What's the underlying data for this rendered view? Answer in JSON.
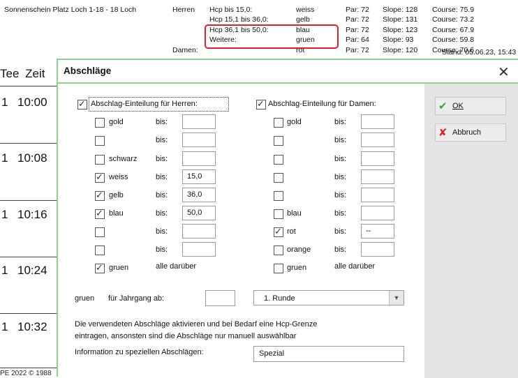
{
  "background": {
    "course_title": "Sonnenschein Platz Loch 1-18 - 18 Loch",
    "herren_label": "Herren",
    "damen_label": "Damen:",
    "stand": "Stand: 05.06.23, 15:43",
    "tee_rows": [
      {
        "hcp": "Hcp bis 15,0:",
        "tee": "weiss",
        "par": "Par: 72",
        "slope": "Slope: 128",
        "course": "Course: 75.9"
      },
      {
        "hcp": "Hcp 15,1 bis 36,0:",
        "tee": "gelb",
        "par": "Par: 72",
        "slope": "Slope: 131",
        "course": "Course: 73.2"
      },
      {
        "hcp": "Hcp 36,1 bis 50,0:",
        "tee": "blau",
        "par": "Par: 72",
        "slope": "Slope: 123",
        "course": "Course: 67.9"
      },
      {
        "hcp": "Weitere:",
        "tee": "gruen",
        "par": "Par: 64",
        "slope": "Slope:  93",
        "course": "Course: 59.8"
      },
      {
        "hcp": "",
        "tee": "rot",
        "par": "Par: 72",
        "slope": "Slope: 120",
        "course": "Course: 70.6"
      }
    ],
    "tee_header": "Tee",
    "zeit_header": "Zeit",
    "times": [
      {
        "tee": "1",
        "time": "10:00"
      },
      {
        "tee": "1",
        "time": "10:08"
      },
      {
        "tee": "1",
        "time": "10:16"
      },
      {
        "tee": "1",
        "time": "10:24"
      },
      {
        "tee": "1",
        "time": "10:32"
      }
    ],
    "footer": "PE 2022 © 1988"
  },
  "dialog": {
    "title": "Abschläge",
    "ok_label": "OK",
    "cancel_label": "Abbruch",
    "herren_header": "Abschlag-Einteilung für Herren:",
    "damen_header": "Abschlag-Einteilung für Damen:",
    "bis_label": "bis:",
    "alle_label": "alle darüber",
    "herren_rows": [
      {
        "checked": false,
        "label": "gold",
        "value": ""
      },
      {
        "checked": false,
        "label": "",
        "value": ""
      },
      {
        "checked": false,
        "label": "schwarz",
        "value": ""
      },
      {
        "checked": true,
        "label": "weiss",
        "value": "15,0"
      },
      {
        "checked": true,
        "label": "gelb",
        "value": "36,0"
      },
      {
        "checked": true,
        "label": "blau",
        "value": "50,0"
      },
      {
        "checked": false,
        "label": "",
        "value": ""
      },
      {
        "checked": false,
        "label": "",
        "value": ""
      },
      {
        "checked": true,
        "label": "gruen",
        "value": null
      }
    ],
    "damen_rows": [
      {
        "checked": false,
        "label": "gold",
        "value": ""
      },
      {
        "checked": false,
        "label": "",
        "value": ""
      },
      {
        "checked": false,
        "label": "",
        "value": ""
      },
      {
        "checked": false,
        "label": "",
        "value": ""
      },
      {
        "checked": false,
        "label": "",
        "value": ""
      },
      {
        "checked": false,
        "label": "blau",
        "value": ""
      },
      {
        "checked": true,
        "label": "rot",
        "value": "--"
      },
      {
        "checked": false,
        "label": "orange",
        "value": ""
      },
      {
        "checked": false,
        "label": "gruen",
        "value": null
      }
    ],
    "jahrgang_tee": "gruen",
    "jahrgang_label": "für Jahrgang ab:",
    "jahrgang_value": "",
    "runde_select": "1. Runde",
    "info_text_1": "Die verwendeten Abschläge aktivieren und bei Bedarf eine Hcp-Grenze",
    "info_text_2": "eintragen, ansonsten sind die Abschläge nur manuell auswählbar",
    "special_label": "Information zu speziellen Abschlägen:",
    "special_value": "Spezial",
    "colors": {
      "dialog_border": "#8fd28f",
      "ok_icon": "#3aa63a",
      "cancel_icon": "#d42a2a",
      "highlight": "#e0202a"
    }
  }
}
